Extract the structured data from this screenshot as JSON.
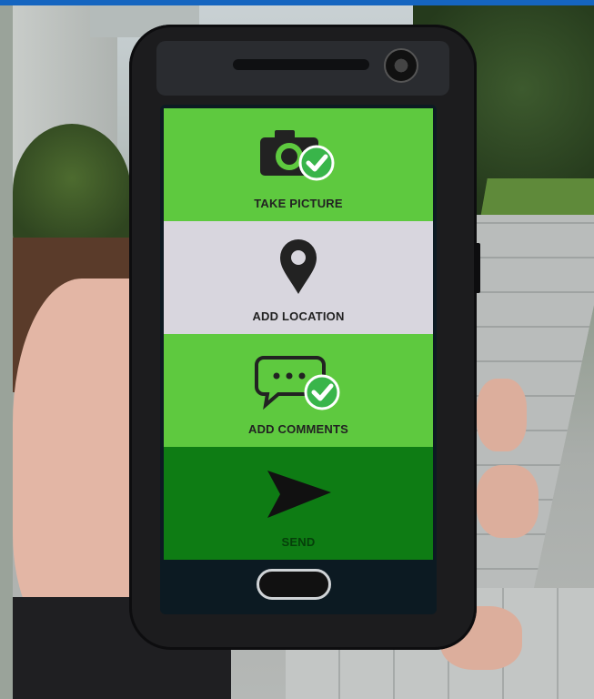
{
  "app": {
    "buttons": [
      {
        "label": "TAKE PICTURE",
        "icon": "camera-check-icon",
        "color": "#5ec93f"
      },
      {
        "label": "ADD LOCATION",
        "icon": "location-pin-icon",
        "color": "#d8d6de"
      },
      {
        "label": "ADD COMMENTS",
        "icon": "chat-check-icon",
        "color": "#5ec93f"
      },
      {
        "label": "SEND",
        "icon": "send-arrow-icon",
        "color": "#0e7c14"
      }
    ]
  },
  "colors": {
    "top_bar": "#1565c0",
    "accent_green": "#5ec93f",
    "dark_green": "#0e7c14",
    "check_green": "#39b54a"
  }
}
